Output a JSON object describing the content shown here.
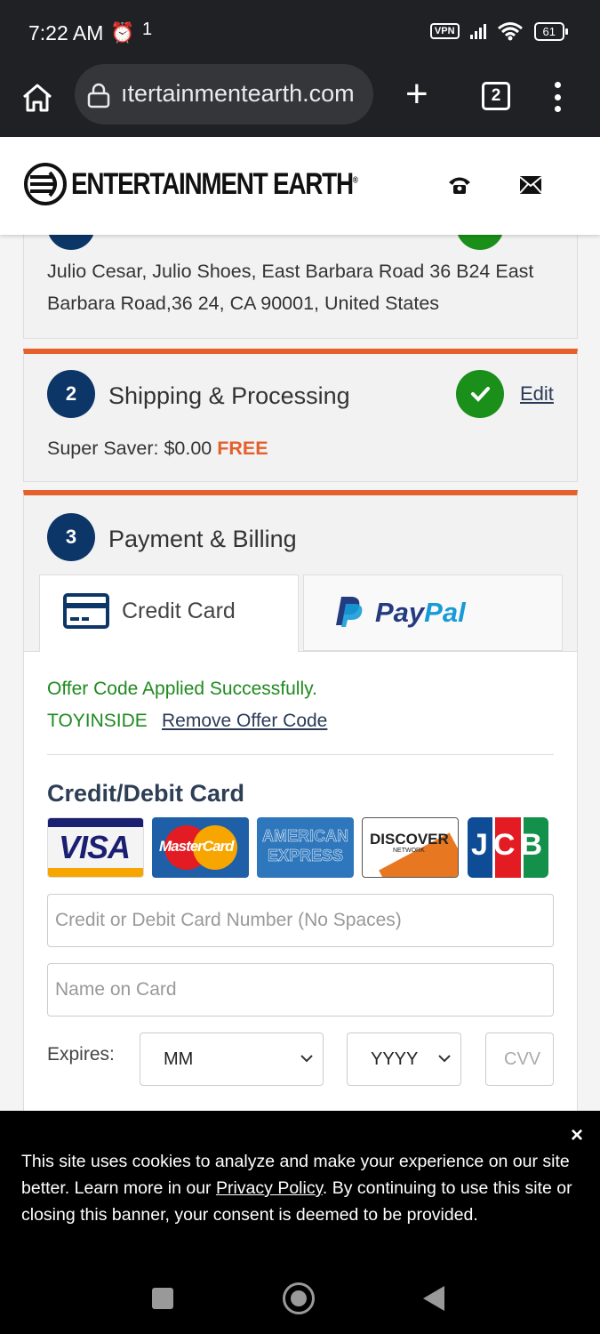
{
  "status_bar": {
    "time": "7:22 AM",
    "alarm_icon": "alarm-clock-icon",
    "indicator": "1",
    "vpn_label": "VPN",
    "battery_level": "61"
  },
  "browser": {
    "url": "ıtertainmentearth.com",
    "tab_count": "2"
  },
  "site": {
    "brand_name": "ENTERTAINMENT EARTH",
    "brand_mark": "®",
    "accent_color": "#e4602c",
    "navy_color": "#0d3668",
    "success_color": "#1a8f1a"
  },
  "address": {
    "text": "Julio Cesar, Julio Shoes, East Barbara Road 36 B24 East Barbara Road,36 24, CA 90001, United States"
  },
  "shipping": {
    "step_number": "2",
    "title": "Shipping & Processing",
    "edit_label": "Edit",
    "method": "Super Saver: $0.00",
    "free_label": "FREE"
  },
  "payment": {
    "step_number": "3",
    "title": "Payment & Billing",
    "tabs": [
      {
        "label": "Credit Card",
        "icon": "credit-card-icon",
        "active": true
      },
      {
        "label": "PayPal",
        "icon": "paypal-logo",
        "active": false
      }
    ],
    "offer_success": "Offer Code Applied Successfully.",
    "offer_code": "TOYINSIDE",
    "remove_offer_label": "Remove Offer Code",
    "card_section_title": "Credit/Debit Card",
    "card_brands": [
      "VISA",
      "MasterCard",
      "AMERICAN EXPRESS",
      "DISCOVER",
      "JCB"
    ],
    "discover_sub": "NETWORK",
    "card_number_placeholder": "Credit or Debit Card Number (No Spaces)",
    "name_placeholder": "Name on Card",
    "expires_label": "Expires:",
    "month_value": "MM",
    "year_value": "YYYY",
    "cvv_placeholder": "CVV"
  },
  "cookie_banner": {
    "text_before": "This site uses cookies to analyze and make your experience on our site better. Learn more in our ",
    "link_label": "Privacy Policy",
    "text_after": ". By continuing to use this site or closing this banner, your consent is deemed to be provided.",
    "close_label": "×"
  }
}
